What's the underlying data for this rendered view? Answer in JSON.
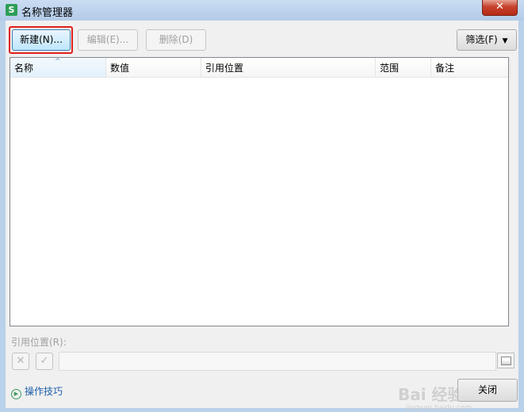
{
  "window": {
    "title": "名称管理器",
    "app_icon": "wps-spreadsheet-icon",
    "close_glyph": "✕"
  },
  "toolbar": {
    "new_label": "新建(N)...",
    "edit_label": "编辑(E)...",
    "delete_label": "删除(D)",
    "filter_label": "筛选(F)"
  },
  "list": {
    "columns": [
      "名称",
      "数值",
      "引用位置",
      "范围",
      "备注"
    ],
    "sort_column": "名称",
    "rows": []
  },
  "reference": {
    "label": "引用位置(R):",
    "value": ""
  },
  "footer": {
    "tips_label": "操作技巧",
    "close_label": "关闭"
  },
  "watermark": {
    "text": "Bai 经验",
    "sub": "jingyan.baidu.com"
  },
  "colors": {
    "highlight": "#e0201b",
    "link": "#1d5fa8",
    "app_icon": "#2e9e57"
  }
}
